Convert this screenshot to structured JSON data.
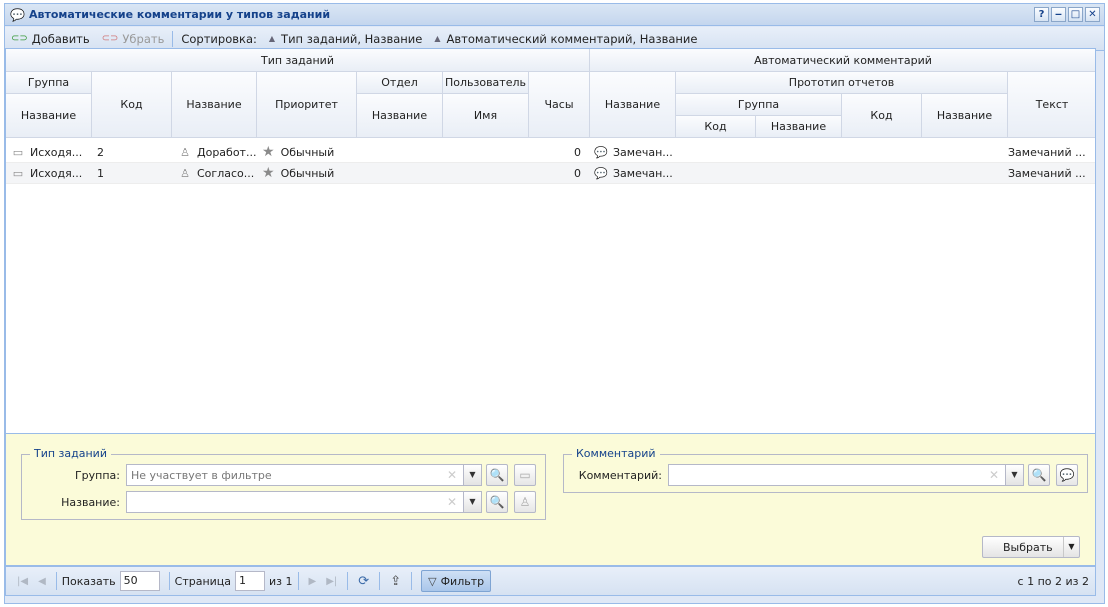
{
  "window": {
    "title": "Автоматические комментарии у типов заданий",
    "buttons": [
      "?",
      "‒",
      "□",
      "✕"
    ]
  },
  "toolbar": {
    "add_label": "Добавить",
    "remove_label": "Убрать",
    "sort_label": "Сортировка:",
    "sort1": "Тип заданий, Название",
    "sort2": "Автоматический комментарий, Название"
  },
  "grid": {
    "group_headers": {
      "task_type": "Тип заданий",
      "auto_comment": "Автоматический комментарий"
    },
    "sub_headers": {
      "group": "Группа",
      "department": "Отдел",
      "user": "Пользователь",
      "report_proto": "Прототип отчетов",
      "report_group": "Группа"
    },
    "columns": {
      "group_name": "Название",
      "code": "Код",
      "name": "Название",
      "priority": "Приоритет",
      "dept_name": "Название",
      "user_name": "Имя",
      "hours": "Часы",
      "comment_name": "Название",
      "rg_code": "Код",
      "rg_name": "Название",
      "rp_code": "Код",
      "rp_name": "Название",
      "text": "Текст"
    },
    "rows": [
      {
        "group": "Исходя...",
        "code": "2",
        "name": "Доработ...",
        "priority": "Обычный",
        "hours": "0",
        "comment": "Замечан...",
        "text": "Замечаний ..."
      },
      {
        "group": "Исходя...",
        "code": "1",
        "name": "Согласо...",
        "priority": "Обычный",
        "hours": "0",
        "comment": "Замечан...",
        "text": "Замечаний ..."
      }
    ]
  },
  "filter": {
    "task_type_legend": "Тип заданий",
    "group_label": "Группа:",
    "group_placeholder": "Не участвует в фильтре",
    "name_label": "Название:",
    "name_value": "",
    "comment_legend": "Комментарий",
    "comment_label": "Комментарий:",
    "comment_value": "",
    "select_button": "Выбрать"
  },
  "pager": {
    "show_label": "Показать",
    "page_size": "50",
    "page_label": "Страница",
    "page": "1",
    "of_label": "из 1",
    "filter_label": "Фильтр",
    "summary": "с 1 по 2 из 2"
  }
}
